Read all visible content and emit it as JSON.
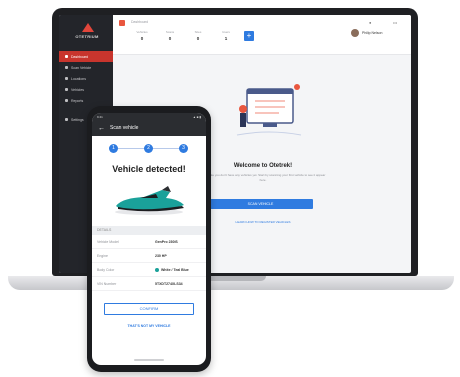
{
  "laptop": {
    "logo_text": "OTETRIUM",
    "sidebar": {
      "items": [
        {
          "label": "Dashboard",
          "active": true
        },
        {
          "label": "Scan Vehicle",
          "active": false
        },
        {
          "label": "Locations",
          "active": false
        },
        {
          "label": "Vehicles",
          "active": false
        },
        {
          "label": "Reports",
          "active": false
        },
        {
          "label": "Settings",
          "active": false
        }
      ]
    },
    "topbar": {
      "breadcrumb": "Dashboard",
      "stats": [
        {
          "label": "Vehicles",
          "value": "0"
        },
        {
          "label": "Scans",
          "value": "0"
        },
        {
          "label": "Sites",
          "value": "0"
        },
        {
          "label": "Users",
          "value": "1"
        }
      ],
      "add_label": "+",
      "icons": [
        "bell-icon",
        "menu-icon"
      ],
      "user_name": "Philip Nelson"
    },
    "welcome": {
      "title": "Welcome to Otetrek!",
      "text": "Looks like you don't have any vehicles yet. Start by scanning your first vehicle to see it appear here.",
      "primary_button": "SCAN VEHICLE",
      "secondary_link": "LEARN HOW TO REGISTER VEHICLES"
    },
    "colors": {
      "accent": "#2f7be0",
      "sidebar_active": "#c8352d",
      "brand": "#e9573f"
    }
  },
  "phone": {
    "status_time": "9:41",
    "status_icons": "▲ ■ ▮",
    "header_title": "Scan vehicle",
    "steps": [
      "1",
      "2",
      "3"
    ],
    "detected_title": "Vehicle detected!",
    "section_label": "DETAILS",
    "rows": [
      {
        "key": "Vehicle Model",
        "value": "GenPro 230iS"
      },
      {
        "key": "Engine",
        "value": "230 HP"
      },
      {
        "key": "Body Color",
        "value": "White / Teal Blue",
        "swatch": "#1aa19a"
      },
      {
        "key": "VIN Number",
        "value": "5TXDT274XLS34"
      }
    ],
    "confirm_button": "CONFIRM",
    "rescan_button": "THAT'S NOT MY VEHICLE"
  }
}
